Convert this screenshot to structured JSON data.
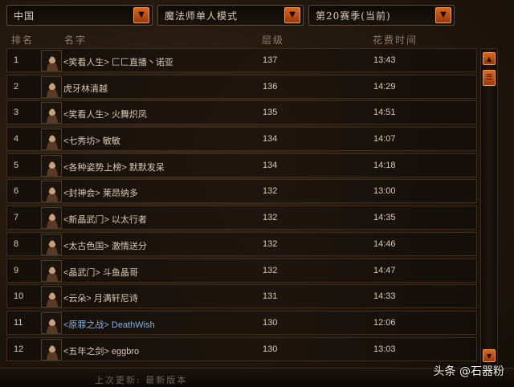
{
  "filters": {
    "region": "中国",
    "mode": "魔法师单人模式",
    "season": "第20赛季(当前)"
  },
  "header": {
    "rank": "排名",
    "name": "名字",
    "level": "层级",
    "time": "花费时间"
  },
  "rows": [
    {
      "rank": "1",
      "name": "<笑看人生> 匚匚直播丶诺亚",
      "level": "137",
      "time": "13:43"
    },
    {
      "rank": "2",
      "name": "虎牙林清越",
      "level": "136",
      "time": "14:29"
    },
    {
      "rank": "3",
      "name": "<笑看人生> 火舞炽凤",
      "level": "135",
      "time": "14:51"
    },
    {
      "rank": "4",
      "name": "<七秀坊> 敏敏",
      "level": "134",
      "time": "14:07"
    },
    {
      "rank": "5",
      "name": "<各种姿势上榜> 默默发呆",
      "level": "134",
      "time": "14:18"
    },
    {
      "rank": "6",
      "name": "<封神会> 莱昂纳多",
      "level": "132",
      "time": "13:00"
    },
    {
      "rank": "7",
      "name": "<新晶武门> 以太行者",
      "level": "132",
      "time": "14:35"
    },
    {
      "rank": "8",
      "name": "<太古色国> 激情送分",
      "level": "132",
      "time": "14:46"
    },
    {
      "rank": "9",
      "name": "<晶武门> 斗鱼晶哥",
      "level": "132",
      "time": "14:47"
    },
    {
      "rank": "10",
      "name": "<云朵> 月满轩尼诗",
      "level": "131",
      "time": "14:33"
    },
    {
      "rank": "11",
      "name": "<原罪之战> DeathWish",
      "level": "130",
      "time": "12:06",
      "highlight": true
    },
    {
      "rank": "12",
      "name": "<五年之剑> eggbro",
      "level": "130",
      "time": "13:03"
    }
  ],
  "footer": {
    "text": "上次更新: 最新版本"
  },
  "watermark": "头条 @石器粉",
  "icons": {
    "dropdown": "chevron-down-icon",
    "scroll_up": "arrow-up-icon",
    "scroll_thumb": "scroll-thumb-icon",
    "scroll_down": "arrow-down-icon",
    "avatar": "wizard-portrait-icon"
  },
  "colors": {
    "accent": "#d9661e",
    "highlight_name": "#7fb3e6",
    "text": "#d6cab3"
  }
}
